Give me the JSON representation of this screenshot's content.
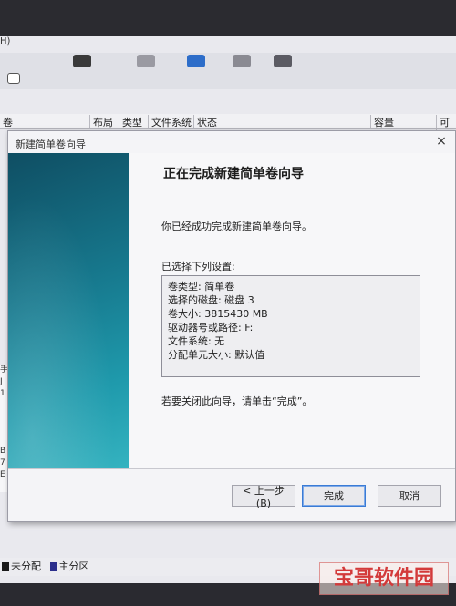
{
  "background": {
    "menu_fragment": "H)",
    "columns": [
      "卷",
      "布局",
      "类型",
      "文件系统",
      "状态",
      "容量",
      "可用"
    ],
    "left_fragments": [
      "手",
      "J",
      "1",
      "B",
      "7",
      "E"
    ],
    "legend": [
      {
        "label": "未分配",
        "color": "#1a1a1a"
      },
      {
        "label": "主分区",
        "color": "#2b2f8c"
      }
    ],
    "toolbar_icon_colors": [
      "#3a3a3a",
      "#2d6dc9",
      "#4a4a4a",
      "#7a7a7a"
    ]
  },
  "dialog": {
    "title": "新建简单卷向导",
    "close_glyph": "×",
    "heading": "正在完成新建简单卷向导",
    "description": "你已经成功完成新建简单卷向导。",
    "settings_label": "已选择下列设置:",
    "settings": [
      "卷类型: 简单卷",
      "选择的磁盘: 磁盘 3",
      "卷大小: 3815430 MB",
      "驱动器号或路径: F:",
      "文件系统: 无",
      "分配单元大小: 默认值"
    ],
    "close_hint": "若要关闭此向导，请单击“完成”。",
    "buttons": {
      "back": "< 上一步(B)",
      "finish": "完成",
      "cancel": "取消"
    }
  },
  "watermark": "宝哥软件园"
}
